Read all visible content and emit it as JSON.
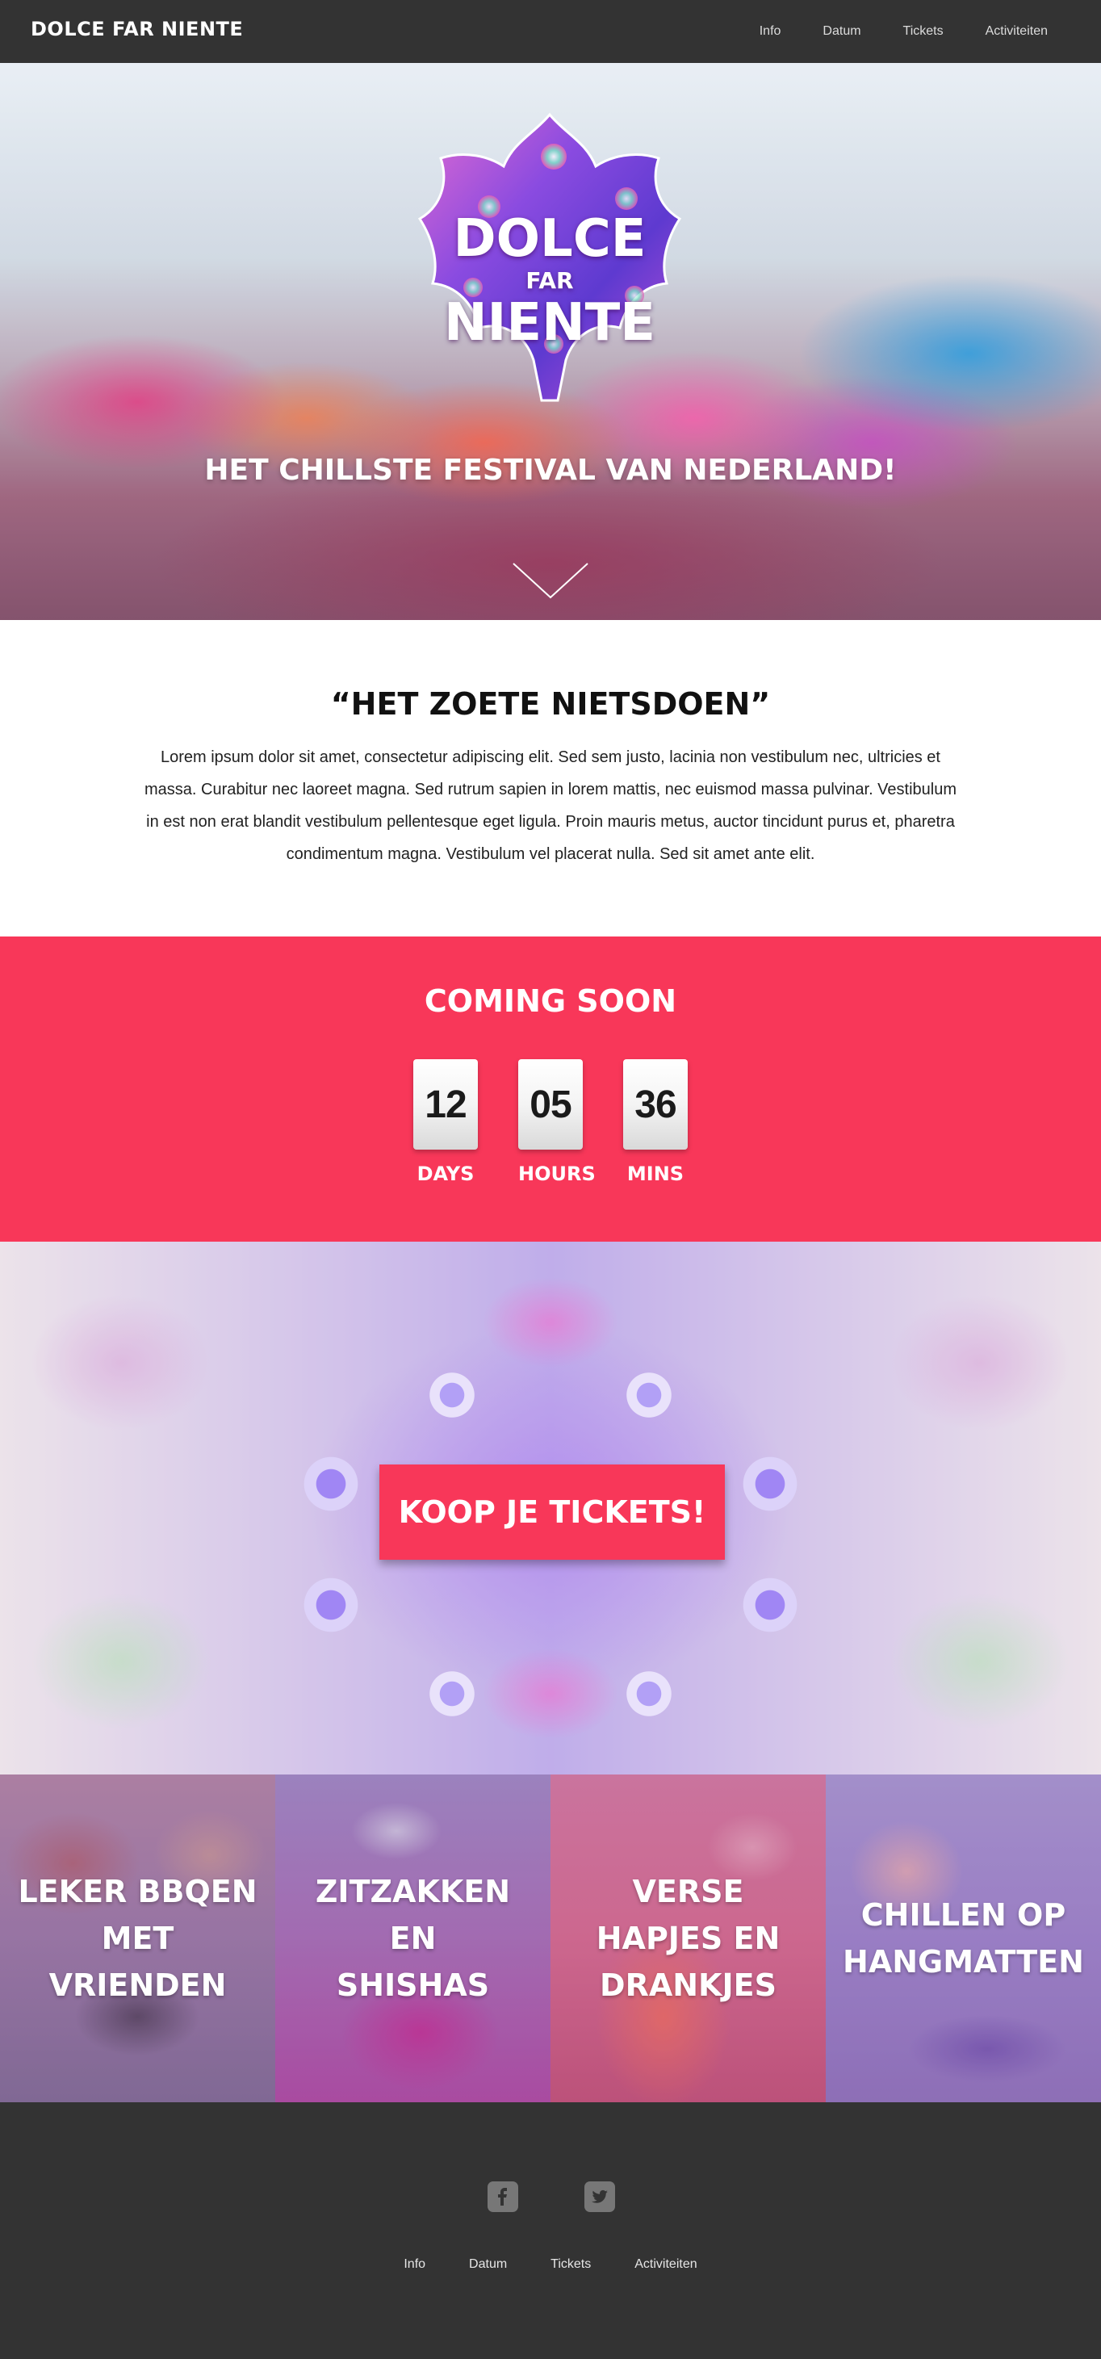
{
  "nav": {
    "brand": "DOLCE FAR NIENTE",
    "links": [
      "Info",
      "Datum",
      "Tickets",
      "Activiteiten"
    ]
  },
  "hero": {
    "logo": {
      "line1": "DOLCE",
      "line2": "FAR",
      "line3": "NIENTE"
    },
    "tagline": "HET CHILLSTE FESTIVAL VAN NEDERLAND!",
    "scroll_icon": "chevron-down-icon"
  },
  "intro": {
    "title": "“HET ZOETE NIETSDOEN”",
    "text": "Lorem ipsum dolor sit amet, consectetur adipiscing elit. Sed sem justo, lacinia non vestibulum nec, ultricies et massa. Curabitur nec laoreet magna. Sed rutrum sapien in lorem mattis, nec euismod massa pulvinar. Vestibulum in est non erat blandit vestibulum pellentesque eget ligula. Proin mauris metus, auctor tincidunt purus et, pharetra condimentum magna. Vestibulum vel placerat nulla. Sed sit amet ante elit."
  },
  "countdown": {
    "title": "COMING SOON",
    "items": [
      {
        "value": "12",
        "label": "DAYS"
      },
      {
        "value": "05",
        "label": "HOURS"
      },
      {
        "value": "36",
        "label": "MINS"
      }
    ]
  },
  "tickets": {
    "button_label": "KOOP JE TICKETS!"
  },
  "activities": [
    {
      "line1": "LEKER BBQEN",
      "line2": "MET VRIENDEN",
      "line3": ""
    },
    {
      "line1": "ZITZAKKEN",
      "line2": "EN",
      "line3": "SHISHAS"
    },
    {
      "line1": "VERSE",
      "line2": "HAPJES EN",
      "line3": "DRANKJES"
    },
    {
      "line1": "CHILLEN OP",
      "line2": "HANGMATTEN",
      "line3": ""
    }
  ],
  "footer": {
    "social": [
      "facebook-icon",
      "twitter-icon"
    ],
    "links": [
      "Info",
      "Datum",
      "Tickets",
      "Activiteiten"
    ]
  },
  "colors": {
    "nav_bg": "#333333",
    "accent": "#f83759",
    "footer_bg": "#333333"
  }
}
